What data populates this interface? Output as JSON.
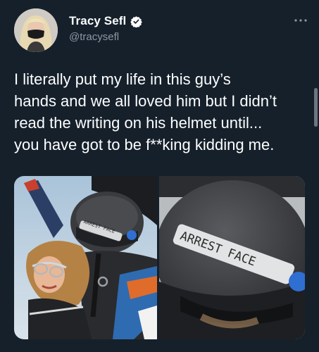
{
  "author": {
    "display_name": "Tracy Sefl",
    "handle": "@tracysefl",
    "verified": true
  },
  "tweet": {
    "text_lines": [
      "I literally put my life in this guy’s",
      "hands and we all loved him but I didn’t",
      "read the writing on his helmet until...",
      "you have got to be f**king kidding me."
    ]
  },
  "media": {
    "photos": [
      {
        "helmet_text": "ARREST FACE"
      },
      {
        "helmet_text": "ARREST FACE"
      }
    ]
  },
  "icons": {
    "more": "more-horizontal-icon",
    "verified": "verified-badge-icon"
  },
  "colors": {
    "background": "#15202b",
    "text_primary": "#ffffff",
    "text_secondary": "#8b98a5",
    "verified_blue": "#ffffff"
  }
}
